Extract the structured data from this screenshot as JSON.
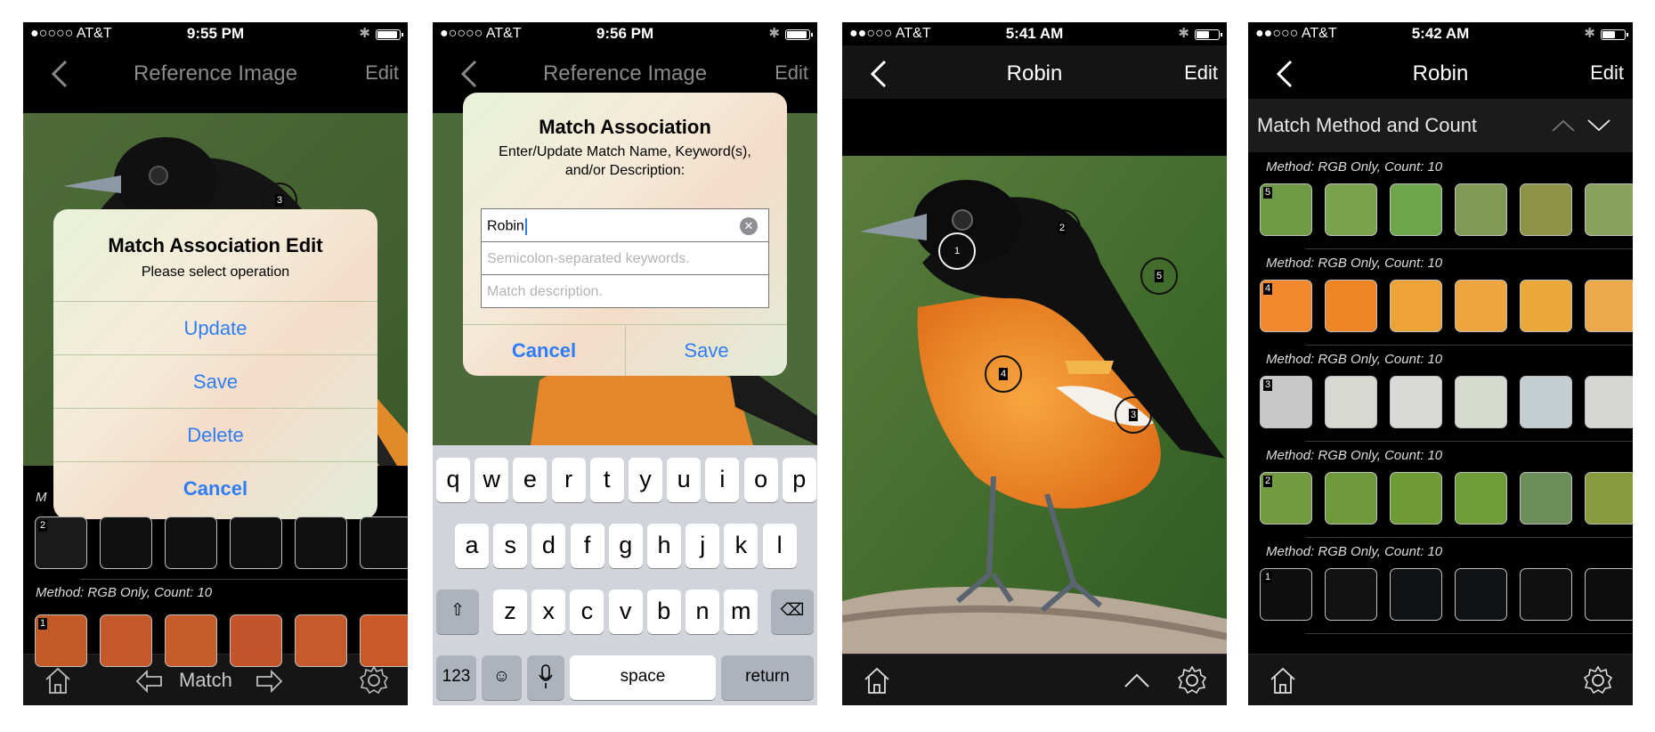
{
  "status_bars": [
    {
      "carrier": "●○○○○ AT&T",
      "time": "9:55 PM"
    },
    {
      "carrier": "●○○○○ AT&T",
      "time": "9:56 PM"
    },
    {
      "carrier": "●●○○○ AT&T",
      "time": "5:41 AM"
    },
    {
      "carrier": "●●○○○ AT&T",
      "time": "5:42 AM"
    }
  ],
  "screens": {
    "s1": {
      "nav_title": "Reference Image",
      "nav_edit": "Edit",
      "dialog": {
        "title": "Match Association Edit",
        "message": "Please select operation",
        "buttons": [
          "Update",
          "Save",
          "Delete",
          "Cancel"
        ]
      },
      "method_label_partial": "M",
      "method_label": "Method: RGB Only, Count: 10",
      "swatch_rows": [
        {
          "index": "2",
          "colors": [
            "#1a1a1a",
            "#101010",
            "#101010",
            "#101010",
            "#101010",
            "#101010"
          ]
        },
        {
          "index": "1",
          "colors": [
            "#c25a26",
            "#c5582a",
            "#c55c2a",
            "#c4542a",
            "#c65a2c",
            "#c95a28"
          ]
        }
      ],
      "tabbar": {
        "match_label": "Match"
      }
    },
    "s2": {
      "nav_title": "Reference Image",
      "nav_edit": "Edit",
      "dialog": {
        "title": "Match Association",
        "message": "Enter/Update Match Name, Keyword(s), and/or Description:",
        "name_value": "Robin",
        "keywords_placeholder": "Semicolon-separated keywords.",
        "description_placeholder": "Match description.",
        "cancel": "Cancel",
        "save": "Save"
      },
      "keyboard": {
        "row1": [
          "q",
          "w",
          "e",
          "r",
          "t",
          "y",
          "u",
          "i",
          "o",
          "p"
        ],
        "row2": [
          "a",
          "s",
          "d",
          "f",
          "g",
          "h",
          "j",
          "k",
          "l"
        ],
        "row3": [
          "z",
          "x",
          "c",
          "v",
          "b",
          "n",
          "m"
        ],
        "numbers": "123",
        "space": "space",
        "return": "return"
      }
    },
    "s3": {
      "nav_title": "Robin",
      "nav_edit": "Edit",
      "markers": [
        "1",
        "2",
        "3",
        "4",
        "5"
      ]
    },
    "s4": {
      "nav_title": "Robin",
      "nav_edit": "Edit",
      "section_title": "Match Method and Count",
      "method_label": "Method: RGB Only, Count: 10",
      "swatch_rows": [
        {
          "index": "5",
          "colors": [
            "#6f9a45",
            "#78a24c",
            "#6ea54b",
            "#7e9a55",
            "#8e9244",
            "#87a25c"
          ]
        },
        {
          "index": "4",
          "colors": [
            "#f2892e",
            "#ee8628",
            "#eea338",
            "#efa640",
            "#eda83c",
            "#eda84a"
          ]
        },
        {
          "index": "3",
          "colors": [
            "#c8c8c8",
            "#d7d8d2",
            "#d9dad7",
            "#d6dace",
            "#c5cfd3",
            "#d6d6d2"
          ]
        },
        {
          "index": "2",
          "colors": [
            "#729a3e",
            "#6f9a3c",
            "#6e9a34",
            "#6e9c36",
            "#6c8e5a",
            "#889b3c"
          ]
        },
        {
          "index": "1",
          "colors": [
            "#0f0f0f",
            "#121212",
            "#111214",
            "#111214",
            "#101010",
            "#0c0c0c"
          ]
        }
      ]
    }
  }
}
